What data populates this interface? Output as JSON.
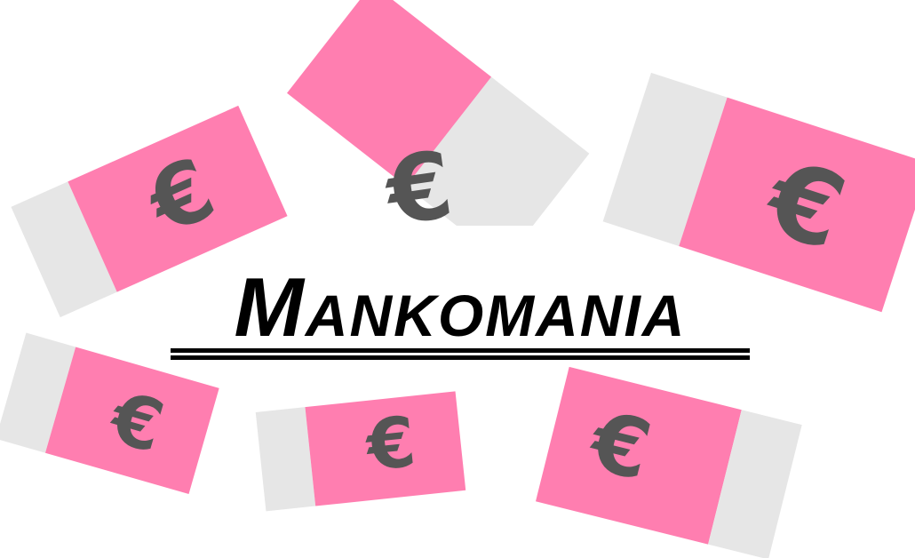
{
  "title": "Mankomania",
  "currency_symbol": "€",
  "colors": {
    "background": "#ffffff",
    "banknote_pink": "#ff7eb0",
    "banknote_grey": "#e6e6e6",
    "euro_symbol": "#555555",
    "title": "#000000"
  },
  "banknotes": [
    {
      "name": "banknote-top-left"
    },
    {
      "name": "banknote-top-center"
    },
    {
      "name": "banknote-top-right"
    },
    {
      "name": "banknote-bottom-left"
    },
    {
      "name": "banknote-bottom-center"
    },
    {
      "name": "banknote-bottom-right"
    }
  ]
}
